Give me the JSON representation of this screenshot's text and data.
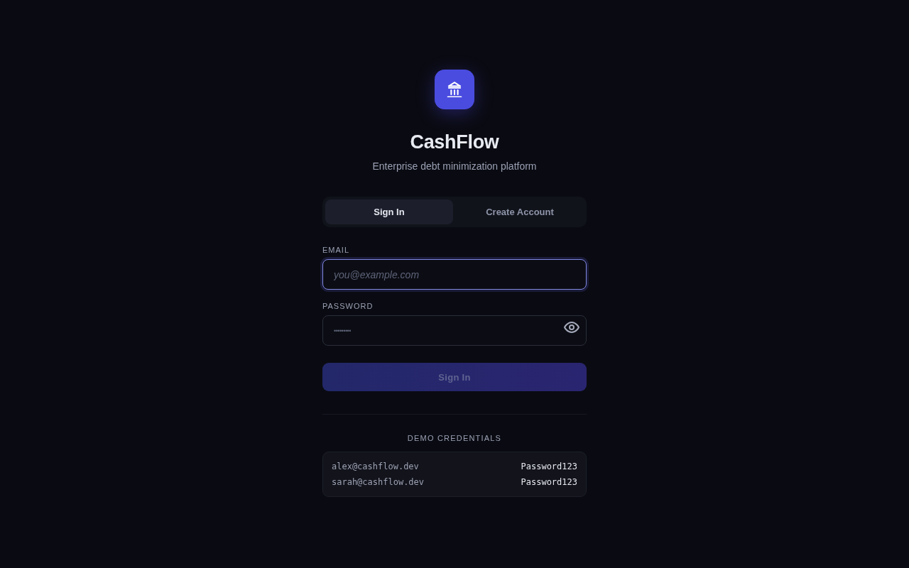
{
  "brand": {
    "name": "CashFlow",
    "tagline": "Enterprise debt minimization platform"
  },
  "tabs": [
    {
      "label": "Sign In",
      "selected": true
    },
    {
      "label": "Create Account",
      "selected": false
    }
  ],
  "fields": [
    {
      "kind": "email",
      "label": "EMAIL",
      "placeholder": "you@example.com",
      "focused": true
    },
    {
      "kind": "password",
      "label": "PASSWORD",
      "placeholder": "•••••••••",
      "focused": false
    }
  ],
  "submit": {
    "label": "Sign In",
    "disabled": true
  },
  "demo": {
    "heading": "DEMO CREDENTIALS",
    "rows": [
      {
        "email": "alex@cashflow.dev",
        "password": "Password123"
      },
      {
        "email": "sarah@cashflow.dev",
        "password": "Password123"
      }
    ]
  }
}
